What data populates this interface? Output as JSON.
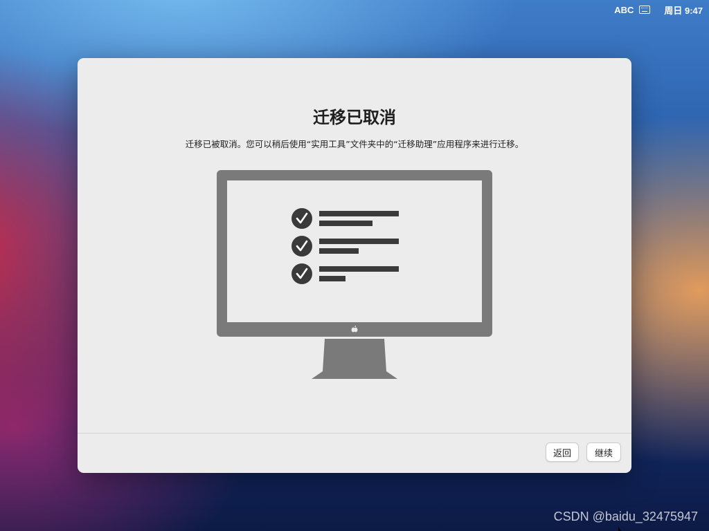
{
  "menubar": {
    "input_source": "ABC",
    "keyboard_icon": "keyboard-icon",
    "clock": "周日 9:47"
  },
  "dialog": {
    "title": "迁移已取消",
    "description": "迁移已被取消。您可以稍后使用“实用工具”文件夹中的“迁移助理”应用程序来进行迁移。",
    "illustration": "imac-checklist-illustration",
    "checklist_icon": "checkmark-circle-icon",
    "buttons": {
      "back": "返回",
      "continue": "继续"
    }
  },
  "colors": {
    "window_bg": "#ececec",
    "illustration_gray": "#7a7a7a",
    "dark": "#3a3a3a"
  },
  "watermark": "CSDN @baidu_32475947"
}
